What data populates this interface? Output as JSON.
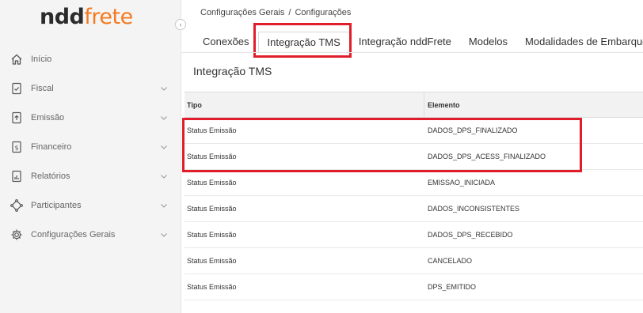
{
  "logo": {
    "part1": "ndd",
    "part2": "frete"
  },
  "sidebar": {
    "items": [
      {
        "label": "Início",
        "icon": "home-icon",
        "expandable": false
      },
      {
        "label": "Fiscal",
        "icon": "document-check-icon",
        "expandable": true
      },
      {
        "label": "Emissão",
        "icon": "document-upload-icon",
        "expandable": true
      },
      {
        "label": "Financeiro",
        "icon": "document-dollar-icon",
        "expandable": true
      },
      {
        "label": "Relatórios",
        "icon": "report-chart-icon",
        "expandable": true
      },
      {
        "label": "Participantes",
        "icon": "network-icon",
        "expandable": true
      },
      {
        "label": "Configurações Gerais",
        "icon": "gear-icon",
        "expandable": true
      }
    ],
    "collapse_glyph": "‹"
  },
  "breadcrumb": {
    "items": [
      "Configurações Gerais",
      "Configurações"
    ],
    "separator": "/"
  },
  "tabs": [
    {
      "label": "Conexões",
      "active": false
    },
    {
      "label": "Integração TMS",
      "active": true
    },
    {
      "label": "Integração nddFrete",
      "active": false
    },
    {
      "label": "Modelos",
      "active": false
    },
    {
      "label": "Modalidades de Embarque",
      "active": false
    }
  ],
  "section_title": "Integração TMS",
  "table": {
    "headers": [
      "Tipo",
      "Elemento"
    ],
    "rows": [
      [
        "Status Emissão",
        "DADOS_DPS_FINALIZADO"
      ],
      [
        "Status Emissão",
        "DADOS_DPS_ACESS_FINALIZADO"
      ],
      [
        "Status Emissão",
        "EMISSAO_INICIADA"
      ],
      [
        "Status Emissão",
        "DADOS_INCONSISTENTES"
      ],
      [
        "Status Emissão",
        "DADOS_DPS_RECEBIDO"
      ],
      [
        "Status Emissão",
        "CANCELADO"
      ],
      [
        "Status Emissão",
        "DPS_EMITIDO"
      ]
    ]
  },
  "colors": {
    "brand_orange": "#f47a20",
    "highlight_red": "#e01e2b",
    "sidebar_bg": "#f4f4f4"
  }
}
